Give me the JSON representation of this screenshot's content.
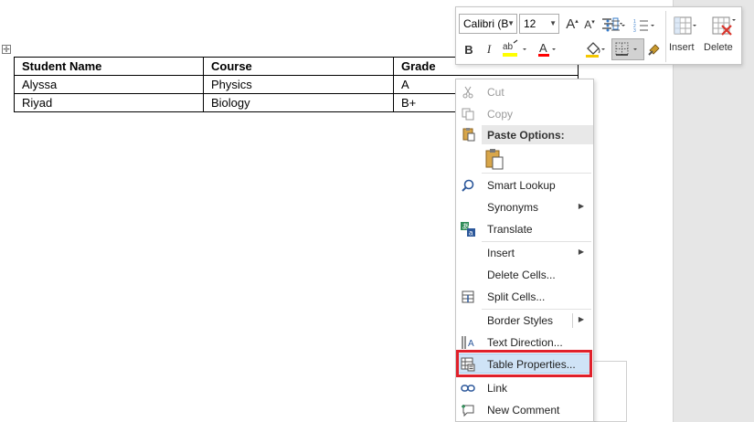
{
  "table": {
    "headers": [
      "Student Name",
      "Course",
      "Grade"
    ],
    "rows": [
      [
        "Alyssa",
        "Physics",
        "A"
      ],
      [
        "Riyad",
        "Biology",
        "B+"
      ]
    ]
  },
  "toolbar": {
    "font_name": "Calibri (B",
    "font_size": "12",
    "insert_label": "Insert",
    "delete_label": "Delete"
  },
  "menu": {
    "cut": "Cut",
    "copy": "Copy",
    "paste_options": "Paste Options:",
    "smart_lookup": "Smart Lookup",
    "synonyms": "Synonyms",
    "translate": "Translate",
    "insert": "Insert",
    "delete_cells": "Delete Cells...",
    "split_cells": "Split Cells...",
    "border_styles": "Border Styles",
    "text_direction": "Text Direction...",
    "table_properties": "Table Properties...",
    "link": "Link",
    "new_comment": "New Comment"
  },
  "colors": {
    "highlight_border": "#e0202a",
    "text_highlight": "#ffff00",
    "font_color": "#ff0000",
    "delete_x": "#d9342b"
  }
}
